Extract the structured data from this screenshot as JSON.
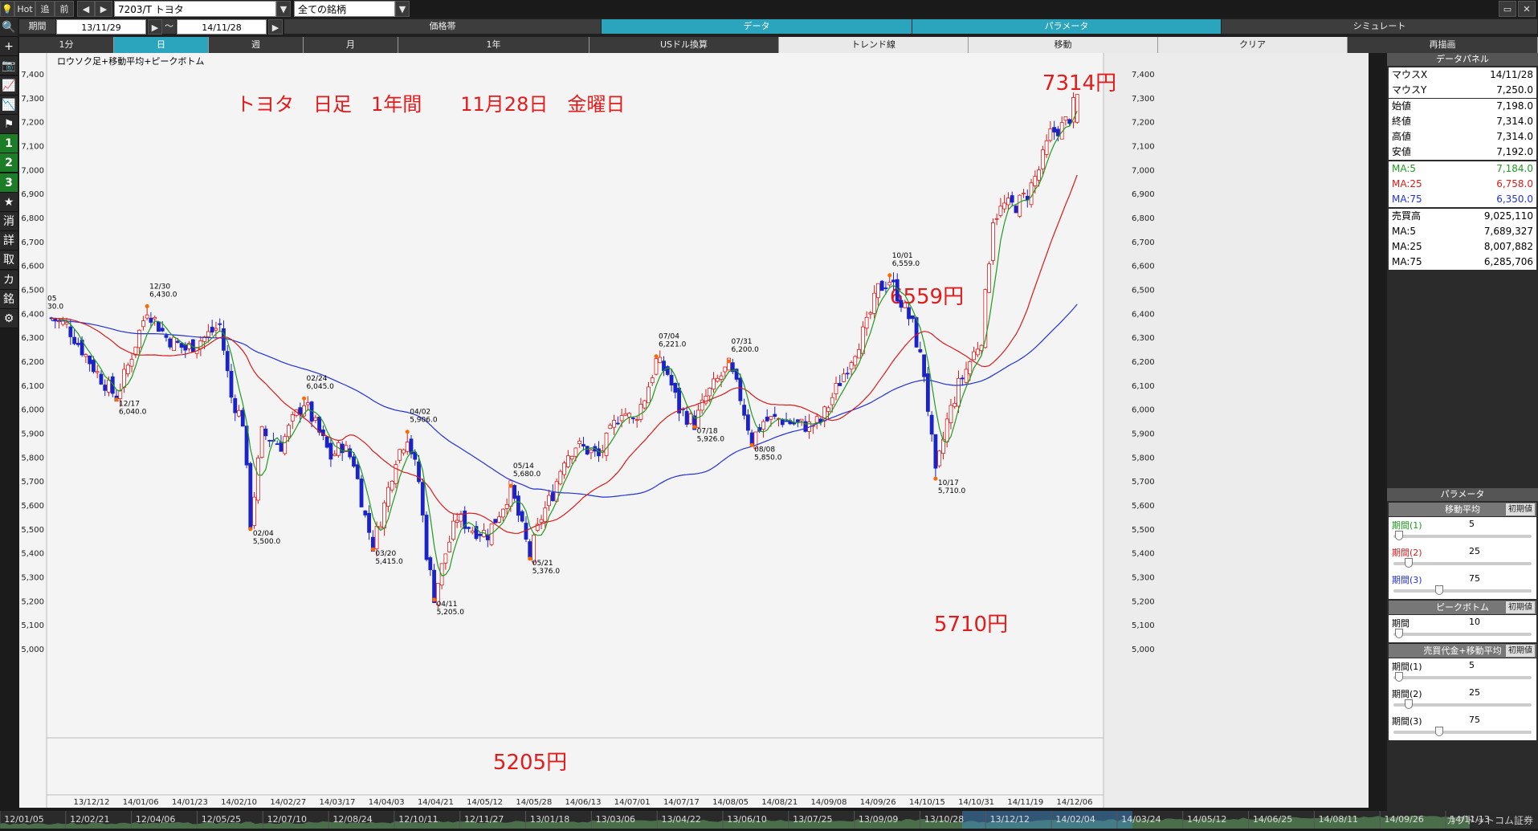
{
  "topbar": {
    "hot": "Hot",
    "follow": "追",
    "prev": "前",
    "ticker": "7203/T トヨタ",
    "market": "全ての銘柄"
  },
  "row2": {
    "period_label": "期間",
    "from_date": "13/11/29",
    "dash": "～",
    "to_date": "14/11/28",
    "tabs": [
      "価格帯",
      "データ",
      "パラメータ",
      "シミュレート"
    ]
  },
  "row3": {
    "tabs": [
      "1分",
      "日",
      "週",
      "月",
      "1年",
      "USドル換算",
      "トレンド線",
      "移動",
      "クリア",
      "再描画"
    ]
  },
  "lefttools": [
    "🔍",
    "+",
    "📷",
    "📈",
    "📉",
    "⚑",
    "1",
    "2",
    "3",
    "★",
    "消",
    "詳",
    "取",
    "カ",
    "銘",
    "⚙"
  ],
  "chart_data": {
    "type": "candlestick",
    "label": "ロウソク足+移動平均+ピークボトム",
    "annotation": "トヨタ　日足　1年間　　11月28日　金曜日",
    "callouts": [
      {
        "text": "7314円",
        "x": "14/11/28",
        "y": 7314
      },
      {
        "text": "6559円",
        "x": "14/10/01",
        "y": 6559
      },
      {
        "text": "5710円",
        "x": "14/10/17",
        "y": 5710
      },
      {
        "text": "5205円",
        "x": "14/04/11",
        "y": 5205
      }
    ],
    "ylim": [
      5000,
      7450
    ],
    "yticks": [
      5000,
      5100,
      5200,
      5300,
      5400,
      5500,
      5600,
      5700,
      5800,
      5900,
      6000,
      6100,
      6200,
      6300,
      6400,
      6500,
      6600,
      6700,
      6800,
      6900,
      7000,
      7100,
      7200,
      7300,
      7400
    ],
    "ytick_labels": [
      "5,000",
      "5,100",
      "5,200",
      "5,300",
      "5,400",
      "5,500",
      "5,600",
      "5,700",
      "5,800",
      "5,900",
      "6,000",
      "6,100",
      "6,200",
      "6,300",
      "6,400",
      "6,500",
      "6,600",
      "6,700",
      "6,800",
      "6,900",
      "7,000",
      "7,100",
      "7,200",
      "7,300",
      "7,400"
    ],
    "xticks": [
      "13/12/12",
      "14/01/06",
      "14/01/23",
      "14/02/10",
      "14/02/27",
      "14/03/17",
      "14/04/03",
      "14/04/21",
      "14/05/12",
      "14/05/28",
      "14/06/13",
      "14/07/01",
      "14/07/17",
      "14/08/05",
      "14/08/21",
      "14/09/08",
      "14/09/26",
      "14/10/15",
      "14/10/31",
      "14/11/19",
      "14/12/06"
    ],
    "peaks": [
      {
        "date": "12/30",
        "price": "6,430.0",
        "label": "12/30",
        "value": 6430,
        "idx": 25,
        "type": "peak"
      },
      {
        "date": "12/17",
        "price": "6,040.0",
        "label": "12/17",
        "value": 6040,
        "idx": 17,
        "type": "bottom"
      },
      {
        "date": "02/04",
        "price": "5,500.0",
        "label": "02/04",
        "value": 5500,
        "idx": 52,
        "type": "bottom"
      },
      {
        "date": "02/24",
        "price": "6,045.0",
        "label": "02/24",
        "value": 6045,
        "idx": 66,
        "type": "peak"
      },
      {
        "date": "03/20",
        "price": "5,415.0",
        "label": "03/20",
        "value": 5415,
        "idx": 84,
        "type": "bottom"
      },
      {
        "date": "04/02",
        "price": "5,906.0",
        "label": "04/02",
        "value": 5906,
        "idx": 93,
        "type": "peak"
      },
      {
        "date": "04/11",
        "price": "5,205.0",
        "label": "04/11",
        "value": 5205,
        "idx": 100,
        "type": "bottom"
      },
      {
        "date": "05/14",
        "price": "5,680.0",
        "label": "05/14",
        "value": 5680,
        "idx": 120,
        "type": "peak"
      },
      {
        "date": "05/21",
        "price": "5,376.0",
        "label": "05/21",
        "value": 5376,
        "idx": 125,
        "type": "bottom"
      },
      {
        "date": "07/04",
        "price": "6,221.0",
        "label": "07/04",
        "value": 6221,
        "idx": 158,
        "type": "peak"
      },
      {
        "date": "07/18",
        "price": "5,926.0",
        "label": "07/18",
        "value": 5926,
        "idx": 168,
        "type": "bottom"
      },
      {
        "date": "07/31",
        "price": "6,200.0",
        "label": "07/31",
        "value": 6200,
        "idx": 177,
        "type": "peak"
      },
      {
        "date": "08/08",
        "price": "5,850.0",
        "label": "08/08",
        "value": 5850,
        "idx": 183,
        "type": "bottom"
      },
      {
        "date": "10/01",
        "price": "6,559.0",
        "label": "10/01",
        "value": 6559,
        "idx": 219,
        "type": "peak"
      },
      {
        "date": "10/17",
        "price": "5,710.0",
        "label": "10/17",
        "value": 5710,
        "idx": 231,
        "type": "bottom"
      }
    ],
    "left_edge_label": {
      "line1": "05",
      "line2": "30.0"
    },
    "keypoints": [
      [
        0,
        6380
      ],
      [
        4,
        6350
      ],
      [
        8,
        6250
      ],
      [
        12,
        6150
      ],
      [
        17,
        6050
      ],
      [
        20,
        6180
      ],
      [
        25,
        6420
      ],
      [
        30,
        6300
      ],
      [
        35,
        6250
      ],
      [
        40,
        6300
      ],
      [
        44,
        6350
      ],
      [
        47,
        6050
      ],
      [
        50,
        5950
      ],
      [
        52,
        5520
      ],
      [
        55,
        5900
      ],
      [
        60,
        5850
      ],
      [
        63,
        5950
      ],
      [
        66,
        6030
      ],
      [
        70,
        5900
      ],
      [
        73,
        5800
      ],
      [
        76,
        5850
      ],
      [
        79,
        5780
      ],
      [
        82,
        5550
      ],
      [
        84,
        5430
      ],
      [
        87,
        5600
      ],
      [
        90,
        5800
      ],
      [
        93,
        5890
      ],
      [
        96,
        5700
      ],
      [
        98,
        5400
      ],
      [
        100,
        5220
      ],
      [
        103,
        5400
      ],
      [
        106,
        5550
      ],
      [
        110,
        5500
      ],
      [
        114,
        5480
      ],
      [
        118,
        5600
      ],
      [
        120,
        5670
      ],
      [
        123,
        5500
      ],
      [
        125,
        5390
      ],
      [
        128,
        5550
      ],
      [
        131,
        5650
      ],
      [
        134,
        5800
      ],
      [
        137,
        5850
      ],
      [
        140,
        5830
      ],
      [
        143,
        5800
      ],
      [
        146,
        5900
      ],
      [
        149,
        6000
      ],
      [
        152,
        5950
      ],
      [
        155,
        6050
      ],
      [
        158,
        6200
      ],
      [
        161,
        6150
      ],
      [
        164,
        6000
      ],
      [
        168,
        5940
      ],
      [
        171,
        6050
      ],
      [
        174,
        6120
      ],
      [
        177,
        6180
      ],
      [
        180,
        6050
      ],
      [
        183,
        5870
      ],
      [
        186,
        5950
      ],
      [
        190,
        5960
      ],
      [
        194,
        5940
      ],
      [
        198,
        5930
      ],
      [
        201,
        5950
      ],
      [
        204,
        6050
      ],
      [
        207,
        6150
      ],
      [
        210,
        6250
      ],
      [
        213,
        6350
      ],
      [
        216,
        6500
      ],
      [
        219,
        6540
      ],
      [
        222,
        6450
      ],
      [
        225,
        6350
      ],
      [
        228,
        6150
      ],
      [
        231,
        5720
      ],
      [
        234,
        5950
      ],
      [
        237,
        6100
      ],
      [
        240,
        6200
      ],
      [
        243,
        6300
      ],
      [
        246,
        6800
      ],
      [
        249,
        6850
      ],
      [
        252,
        6850
      ],
      [
        255,
        6900
      ],
      [
        258,
        7000
      ],
      [
        261,
        7150
      ],
      [
        264,
        7180
      ],
      [
        266,
        7220
      ],
      [
        268,
        7314
      ]
    ],
    "ma_periods": [
      5,
      25,
      75
    ]
  },
  "panel": {
    "title": "データパネル",
    "rows": [
      {
        "label": "マウスX",
        "value": "14/11/28"
      },
      {
        "label": "マウスY",
        "value": "7,250.0"
      },
      {
        "label": "始値",
        "value": "7,198.0"
      },
      {
        "label": "終値",
        "value": "7,314.0"
      },
      {
        "label": "高値",
        "value": "7,314.0"
      },
      {
        "label": "安値",
        "value": "7,192.0"
      },
      {
        "label": "MA:5",
        "value": "7,184.0",
        "color": "#1f9b1f"
      },
      {
        "label": "MA:25",
        "value": "6,758.0",
        "color": "#d81b1b"
      },
      {
        "label": "MA:75",
        "value": "6,350.0",
        "color": "#2231d8"
      },
      {
        "label": "売買高",
        "value": "9,025,110"
      },
      {
        "label": "MA:5",
        "value": "7,689,327"
      },
      {
        "label": "MA:25",
        "value": "8,007,882"
      },
      {
        "label": "MA:75",
        "value": "6,285,706"
      }
    ],
    "param_title": "パラメータ",
    "sections": [
      {
        "title": "移動平均",
        "init": "初期値",
        "items": [
          {
            "name": "期間(1)",
            "value": "5",
            "color": "#1f9b1f",
            "knob": 0.01
          },
          {
            "name": "期間(2)",
            "value": "25",
            "color": "#d81b1b",
            "knob": 0.08
          },
          {
            "name": "期間(3)",
            "value": "75",
            "color": "#2231d8",
            "knob": 0.3
          }
        ]
      },
      {
        "title": "ピークボトム",
        "init": "初期値",
        "items": [
          {
            "name": "期間",
            "value": "10",
            "color": "#000",
            "knob": 0.01
          }
        ]
      },
      {
        "title": "売買代金+移動平均",
        "init": "初期値",
        "items": [
          {
            "name": "期間(1)",
            "value": "5",
            "color": "#000",
            "knob": 0.01
          },
          {
            "name": "期間(2)",
            "value": "25",
            "color": "#000",
            "knob": 0.08
          },
          {
            "name": "期間(3)",
            "value": "75",
            "color": "#000",
            "knob": 0.3
          }
        ]
      }
    ]
  },
  "timeline": {
    "labels": [
      "12/01/05",
      "12/02/21",
      "12/04/06",
      "12/05/25",
      "12/07/10",
      "12/08/24",
      "12/10/11",
      "12/11/27",
      "13/01/18",
      "13/03/06",
      "13/04/22",
      "13/06/10",
      "13/07/25",
      "13/09/09",
      "13/10/28",
      "13/12/12",
      "14/02/04",
      "14/03/24",
      "14/05/12",
      "14/06/25",
      "14/08/11",
      "14/09/26",
      "14/11/13"
    ],
    "brand": "カブドットコム証券"
  },
  "colors": {
    "up": "#d81b1b",
    "down": "#1a23c8",
    "ma5": "#1f9b1f",
    "ma25": "#d81b1b",
    "ma75": "#2231d8",
    "peak": "#ff6a00"
  }
}
